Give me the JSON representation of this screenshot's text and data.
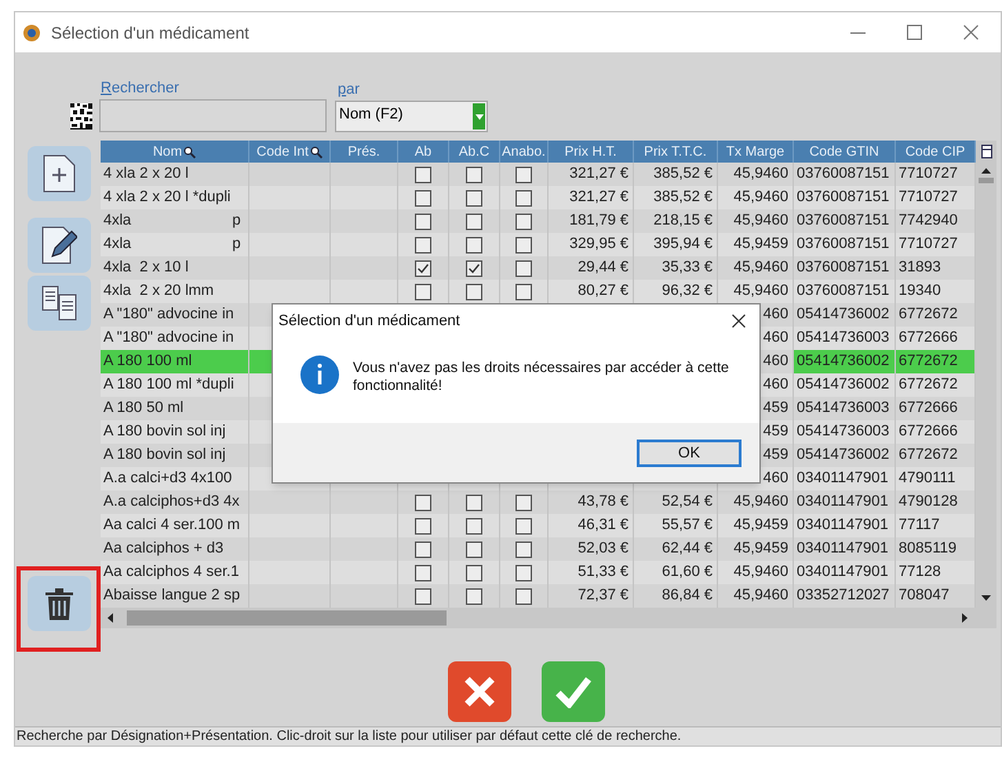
{
  "window": {
    "title": "Sélection d'un médicament"
  },
  "search": {
    "label": "Rechercher",
    "by_label": "par",
    "by_value": "Nom (F2)"
  },
  "table": {
    "columns": [
      {
        "label": "Nom",
        "searchable": true
      },
      {
        "label": "Code Int",
        "searchable": true
      },
      {
        "label": "Prés.",
        "searchable": false
      },
      {
        "label": "Ab",
        "searchable": false
      },
      {
        "label": "Ab.C",
        "searchable": false
      },
      {
        "label": "Anabo.",
        "searchable": false
      },
      {
        "label": "Prix H.T.",
        "searchable": false
      },
      {
        "label": "Prix T.T.C.",
        "searchable": false
      },
      {
        "label": "Tx Marge",
        "searchable": false
      },
      {
        "label": "Code GTIN",
        "searchable": false
      },
      {
        "label": "Code CIP",
        "searchable": false
      }
    ],
    "rows": [
      {
        "name": "4 xla 2 x 20 l",
        "ab": false,
        "abc": false,
        "anabo": false,
        "prix_ht": "321,27 €",
        "prix_ttc": "385,52 €",
        "tx_marge": "45,9460",
        "gtin": "03760087151",
        "cip": "7710727",
        "selected": false
      },
      {
        "name": "4 xla 2 x 20 l *dupli",
        "ab": false,
        "abc": false,
        "anabo": false,
        "prix_ht": "321,27 €",
        "prix_ttc": "385,52 €",
        "tx_marge": "45,9460",
        "gtin": "03760087151",
        "cip": "7710727",
        "selected": false
      },
      {
        "name": "4xla                        p",
        "ab": false,
        "abc": false,
        "anabo": false,
        "prix_ht": "181,79 €",
        "prix_ttc": "218,15 €",
        "tx_marge": "45,9460",
        "gtin": "03760087151",
        "cip": "7742940",
        "selected": false
      },
      {
        "name": "4xla                        p",
        "ab": false,
        "abc": false,
        "anabo": false,
        "prix_ht": "329,95 €",
        "prix_ttc": "395,94 €",
        "tx_marge": "45,9459",
        "gtin": "03760087151",
        "cip": "7710727",
        "selected": false
      },
      {
        "name": "4xla  2 x 10 l",
        "ab": true,
        "abc": true,
        "anabo": false,
        "prix_ht": "29,44 €",
        "prix_ttc": "35,33 €",
        "tx_marge": "45,9460",
        "gtin": "03760087151",
        "cip": "31893",
        "selected": false
      },
      {
        "name": "4xla  2 x 20 lmm",
        "ab": false,
        "abc": false,
        "anabo": false,
        "prix_ht": "80,27 €",
        "prix_ttc": "96,32 €",
        "tx_marge": "45,9460",
        "gtin": "03760087151",
        "cip": "19340",
        "selected": false
      },
      {
        "name": "A \"180\" advocine in",
        "tx_marge": "460",
        "gtin": "05414736002",
        "cip": "6772672",
        "selected": false
      },
      {
        "name": "A \"180\" advocine in",
        "tx_marge": "460",
        "gtin": "05414736003",
        "cip": "6772666",
        "selected": false
      },
      {
        "name": "A 180 100 ml",
        "tx_marge": "460",
        "gtin": "05414736002",
        "cip": "6772672",
        "selected": true
      },
      {
        "name": "A 180 100 ml *dupli",
        "tx_marge": "460",
        "gtin": "05414736002",
        "cip": "6772672",
        "selected": false
      },
      {
        "name": "A 180 50 ml",
        "tx_marge": "459",
        "gtin": "05414736003",
        "cip": "6772666",
        "selected": false
      },
      {
        "name": "A 180 bovin sol inj",
        "tx_marge": "459",
        "gtin": "05414736003",
        "cip": "6772666",
        "selected": false
      },
      {
        "name": "A 180 bovin sol inj",
        "tx_marge": "459",
        "gtin": "05414736002",
        "cip": "6772672",
        "selected": false
      },
      {
        "name": "A.a calci+d3 4x100",
        "tx_marge": "460",
        "gtin": "03401147901",
        "cip": "4790111",
        "selected": false
      },
      {
        "name": "A.a calciphos+d3 4x",
        "ab": false,
        "abc": false,
        "anabo": false,
        "prix_ht": "43,78 €",
        "prix_ttc": "52,54 €",
        "tx_marge": "45,9460",
        "gtin": "03401147901",
        "cip": "4790128",
        "selected": false
      },
      {
        "name": "Aa calci 4 ser.100 m",
        "ab": false,
        "abc": false,
        "anabo": false,
        "prix_ht": "46,31 €",
        "prix_ttc": "55,57 €",
        "tx_marge": "45,9459",
        "gtin": "03401147901",
        "cip": "77117",
        "selected": false
      },
      {
        "name": "Aa calciphos + d3",
        "ab": false,
        "abc": false,
        "anabo": false,
        "prix_ht": "52,03 €",
        "prix_ttc": "62,44 €",
        "tx_marge": "45,9459",
        "gtin": "03401147901",
        "cip": "8085119",
        "selected": false
      },
      {
        "name": "Aa calciphos 4 ser.1",
        "ab": false,
        "abc": false,
        "anabo": false,
        "prix_ht": "51,33 €",
        "prix_ttc": "61,60 €",
        "tx_marge": "45,9460",
        "gtin": "03401147901",
        "cip": "77128",
        "selected": false
      },
      {
        "name": "Abaisse langue 2 sp",
        "ab": false,
        "abc": false,
        "anabo": false,
        "prix_ht": "72,37 €",
        "prix_ttc": "86,84 €",
        "tx_marge": "45,9460",
        "gtin": "03352712027",
        "cip": "708047",
        "selected": false
      }
    ]
  },
  "dialog": {
    "title": "Sélection d'un médicament",
    "message": "Vous n'avez pas les droits nécessaires par accéder à cette fonctionnalité!",
    "button": "OK"
  },
  "status_bar": "Recherche par Désignation+Présentation. Clic-droit sur la liste pour utiliser par défaut cette clé de recherche."
}
